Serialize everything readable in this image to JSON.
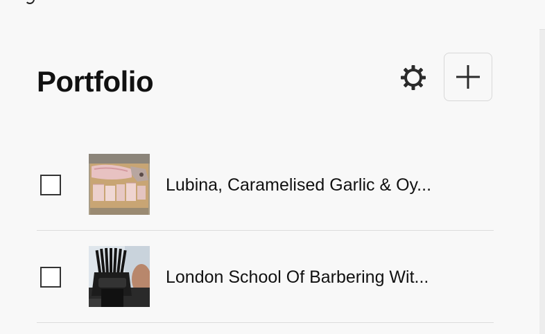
{
  "header": {
    "title": "Portfolio",
    "settings_icon": "gear-icon",
    "add_icon": "plus-icon"
  },
  "items": [
    {
      "title": "Lubina, Caramelised Garlic & Oy...",
      "thumbnail": "fish-fillet-image",
      "checked": false
    },
    {
      "title": "London School Of Barbering Wit...",
      "thumbnail": "barber-comb-image",
      "checked": false
    }
  ],
  "colors": {
    "background": "#f8f8f8",
    "text": "#111111",
    "divider": "#dcdcdc",
    "button_border": "#d8d8d8"
  }
}
